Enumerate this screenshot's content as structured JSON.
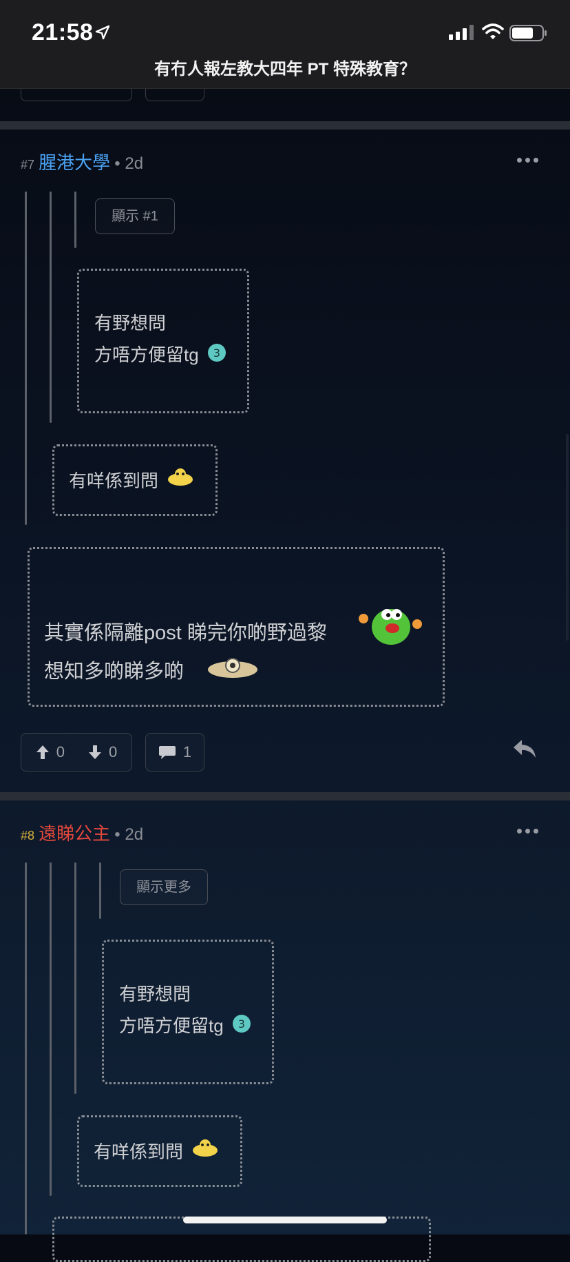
{
  "status_bar": {
    "time": "21:58"
  },
  "thread": {
    "title": "有冇人報左教大四年 PT 特殊教育？"
  },
  "posts": [
    {
      "number": "#7",
      "author": "腥港大學",
      "time": "• 2d",
      "show_label": "顯示 #1",
      "quote_inner_1": "有野想問",
      "quote_inner_2": "方唔方便留tg",
      "quote_mid": "有咩係到問",
      "body_1": "其實係隔離post 睇完你啲野過黎",
      "body_2": "想知多啲睇多啲",
      "upvotes": "0",
      "downvotes": "0",
      "replies": "1"
    },
    {
      "number": "#8",
      "author": "遠睇公主",
      "time": "• 2d",
      "show_label": "顯示更多",
      "quote_inner_1": "有野想問",
      "quote_inner_2": "方唔方便留tg",
      "quote_mid": "有咩係到問"
    }
  ],
  "icons": {
    "location": "location-arrow-icon",
    "signal": "cellular-signal-icon",
    "wifi": "wifi-icon",
    "battery": "battery-icon",
    "more": "more-dots-icon",
    "upvote": "arrow-up-icon",
    "downvote": "arrow-down-icon",
    "comment": "comment-icon",
    "reply": "reply-icon"
  },
  "colors": {
    "author_blue": "#4ba3f5",
    "author_red": "#e4473c",
    "post_number_gold": "#d8b13a"
  }
}
